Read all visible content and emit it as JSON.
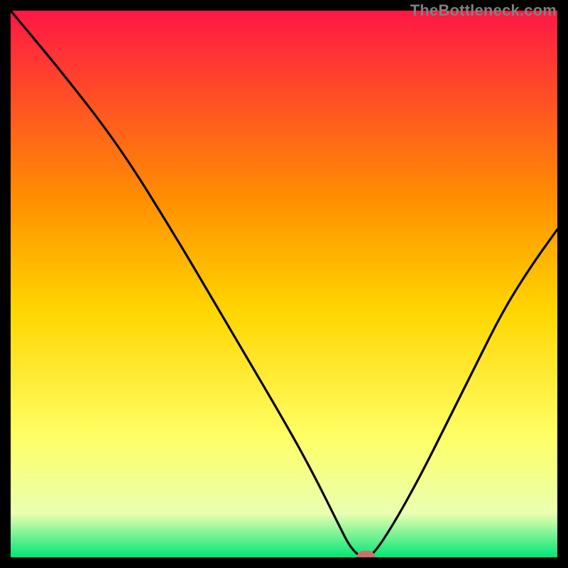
{
  "watermark": "TheBottleneck.com",
  "chart_data": {
    "type": "line",
    "title": "",
    "xlabel": "",
    "ylabel": "",
    "xlim": [
      0,
      100
    ],
    "ylim": [
      0,
      100
    ],
    "series": [
      {
        "name": "bottleneck-curve",
        "x": [
          0,
          10,
          20,
          30,
          40,
          50,
          55,
          60,
          62,
          64,
          66,
          70,
          75,
          80,
          85,
          90,
          95,
          100
        ],
        "values": [
          100,
          88,
          75,
          59,
          42,
          25,
          16,
          6,
          2,
          0,
          0,
          6,
          15,
          25,
          35,
          45,
          53,
          60
        ]
      }
    ],
    "optimal_marker": {
      "x": 65,
      "y": 0
    },
    "gradient_colors": {
      "top": "#ff1744",
      "upper_mid": "#ff9100",
      "mid": "#ffd600",
      "lower_mid": "#ffff66",
      "band_light": "#eaffb0",
      "bottom": "#00e676"
    }
  }
}
